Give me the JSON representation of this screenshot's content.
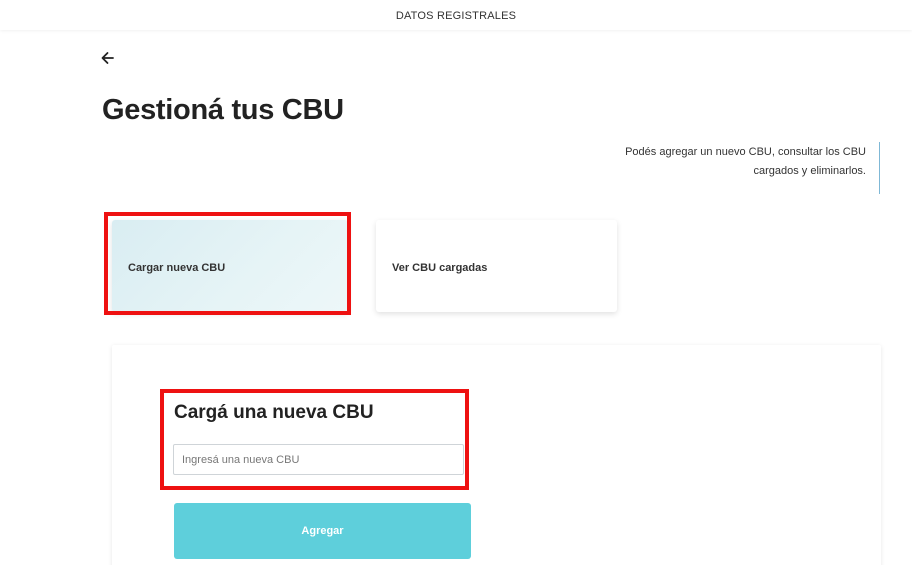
{
  "header": {
    "title": "DATOS REGISTRALES"
  },
  "nav": {
    "back_icon": "arrow-left-icon"
  },
  "page": {
    "title": "Gestioná tus CBU",
    "description_line1": "Podés agregar un nuevo CBU, consultar los CBU",
    "description_line2": "cargados y eliminarlos."
  },
  "options": [
    {
      "label": "Cargar nueva CBU",
      "selected": true
    },
    {
      "label": "Ver CBU cargadas",
      "selected": false
    }
  ],
  "form": {
    "title": "Cargá una nueva CBU",
    "input_placeholder": "Ingresá una nueva CBU",
    "input_value": "",
    "submit_label": "Agregar"
  },
  "colors": {
    "highlight_border": "#ee1111",
    "button_bg": "#5ecfdb",
    "selected_card_bg": "#d9edf2",
    "accent_bar": "#7fb8d6"
  }
}
